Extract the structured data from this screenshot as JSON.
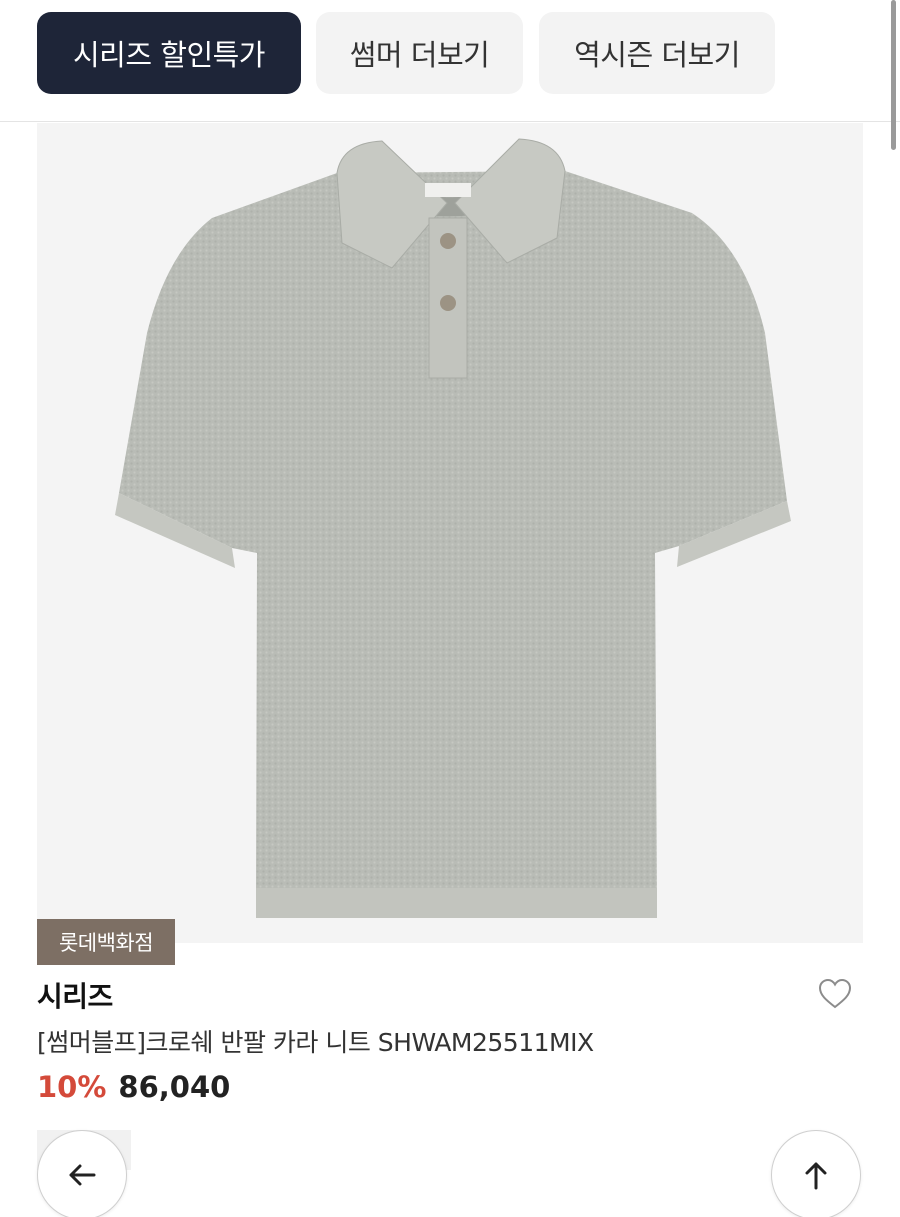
{
  "tabs": {
    "active_label": "시리즈 할인특가",
    "second_label": "썸머 더보기",
    "third_label": "역시즌 더보기"
  },
  "product": {
    "store_badge": "롯데백화점",
    "brand": "시리즈",
    "title": "[썸머블프]크로쉐 반팔 카라 니트 SHWAM25511MIX",
    "discount": "10%",
    "price": "86,040",
    "image_icon": "polo-shirt-image"
  },
  "nav": {
    "back_icon": "arrow-left-icon",
    "top_icon": "arrow-up-icon"
  },
  "colors": {
    "active_tab_bg": "#1e2538",
    "discount_red": "#d44a3a",
    "badge_bg": "#7d6f64"
  }
}
